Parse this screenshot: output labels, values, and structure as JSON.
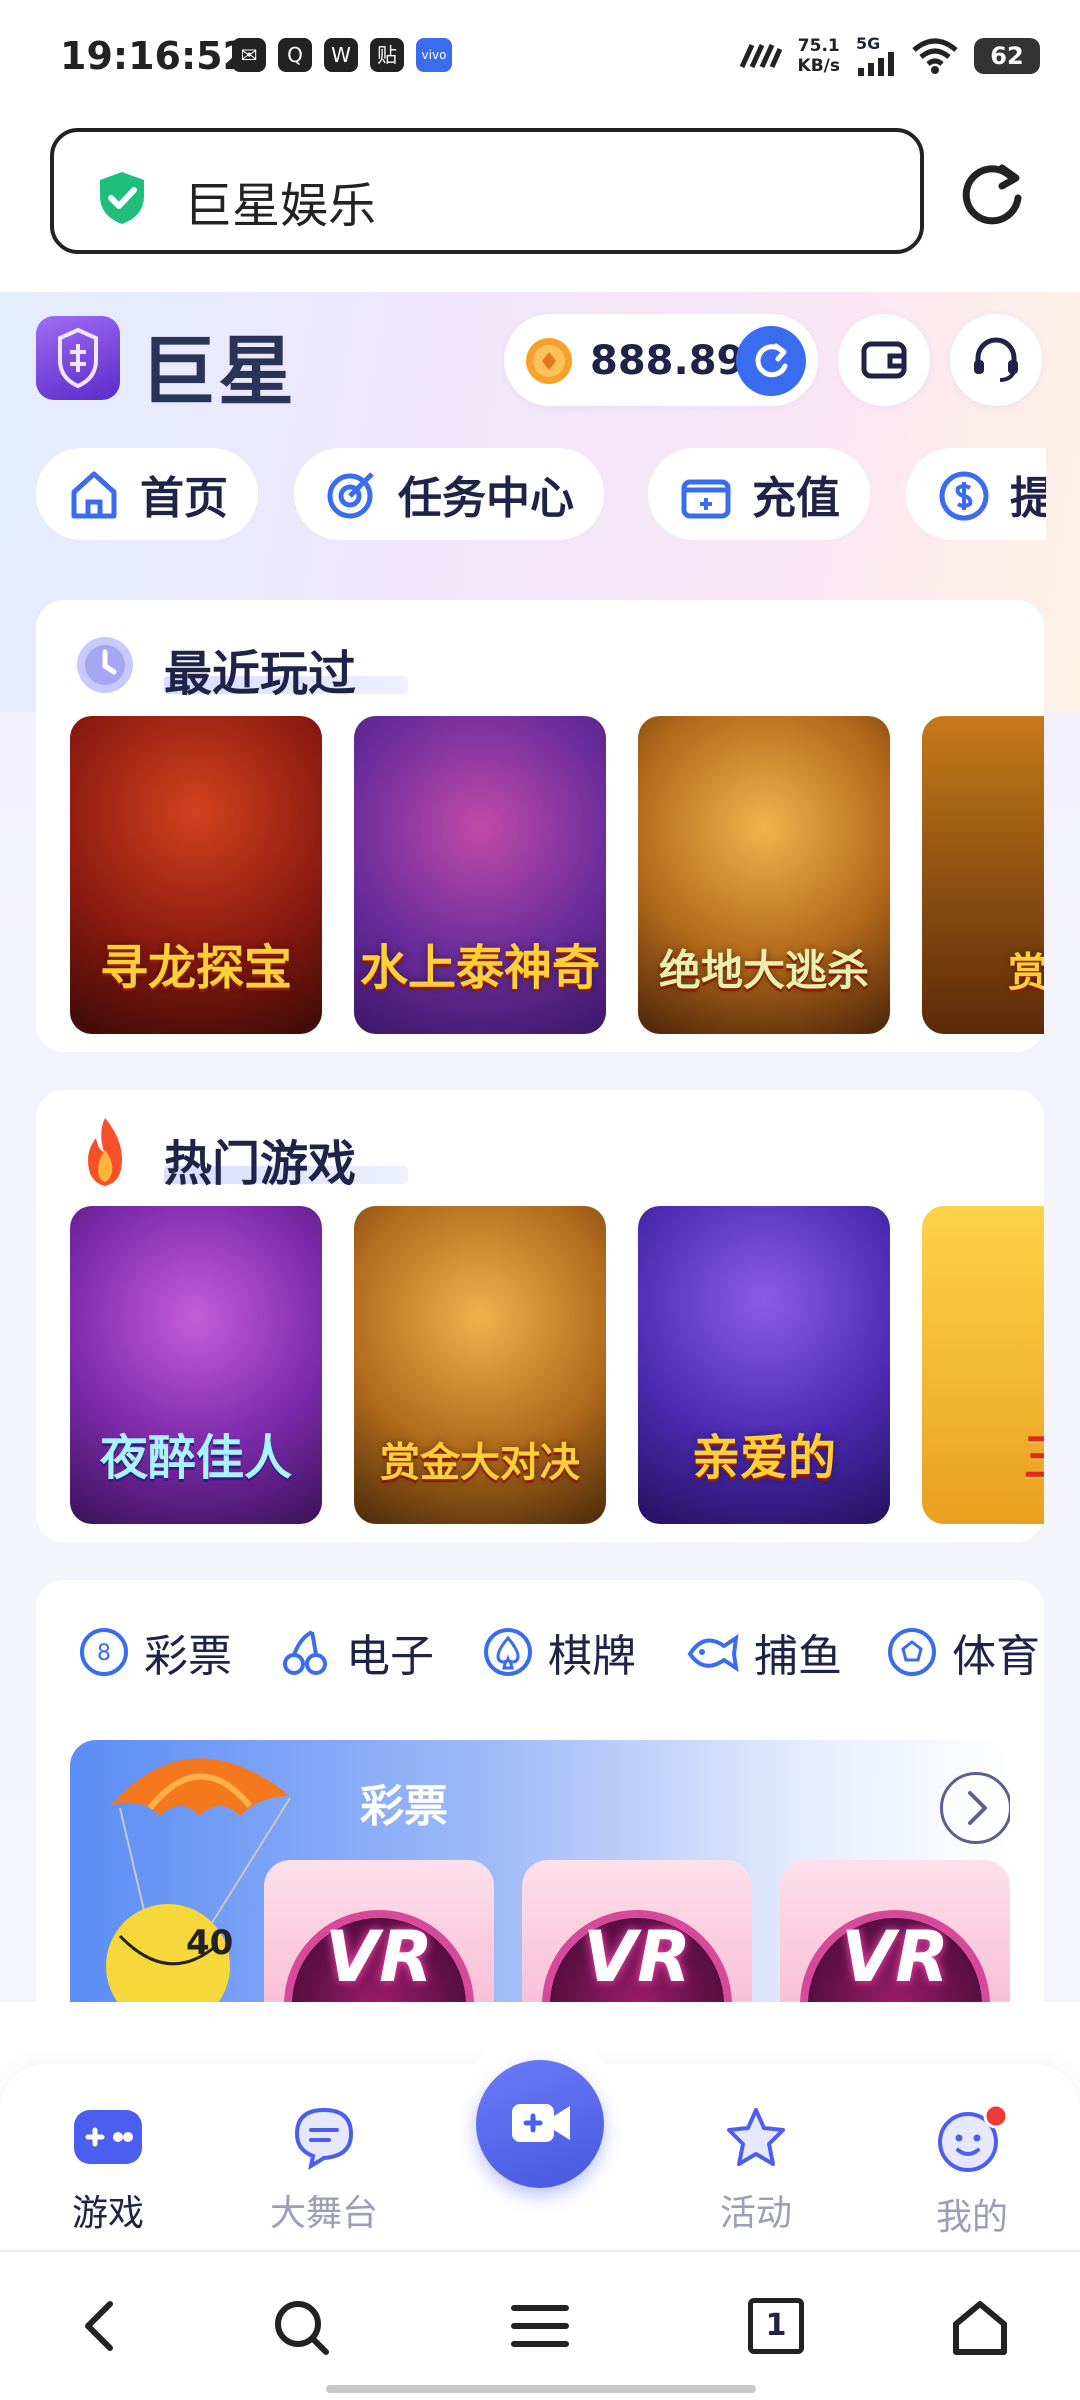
{
  "status_bar": {
    "time": "19:16:52",
    "app_icons": [
      "wechat-icon",
      "qq-icon",
      "weibo-icon",
      "tieba-icon",
      "vivo-icon"
    ],
    "app_icon_glyphs": [
      "✉",
      "Q",
      "W",
      "贴",
      "vivo"
    ],
    "net_speed_value": "75.1",
    "net_speed_unit": "KB/s",
    "network": "5G",
    "battery": "62"
  },
  "browser": {
    "url_text": "巨星娱乐",
    "secure": true
  },
  "site": {
    "brand": "巨星",
    "balance": "888.89",
    "nav": [
      {
        "label": "首页",
        "icon": "home-icon"
      },
      {
        "label": "任务中心",
        "icon": "target-icon"
      },
      {
        "label": "充值",
        "icon": "wallet-plus-icon"
      },
      {
        "label": "提现",
        "icon": "dollar-icon"
      }
    ]
  },
  "recent": {
    "title": "最近玩过",
    "games": [
      "寻龙探宝",
      "水上泰神奇",
      "绝地大逃杀",
      "赏金"
    ]
  },
  "hot": {
    "title": "热门游戏",
    "games": [
      "夜醉佳人",
      "赏金大对决",
      "亲爱的",
      "王"
    ]
  },
  "categories": {
    "items": [
      "彩票",
      "电子",
      "棋牌",
      "捕鱼",
      "体育"
    ],
    "banner_title": "彩票",
    "vr_labels": [
      "VR",
      "VR",
      "VR"
    ]
  },
  "tabbar": {
    "items": [
      {
        "label": "游戏",
        "active": true
      },
      {
        "label": "大舞台",
        "active": false
      },
      {
        "label": "活动",
        "active": false
      },
      {
        "label": "我的",
        "active": false
      }
    ]
  },
  "system_nav": {
    "tab_count": "1"
  },
  "colors": {
    "accent": "#3a6cf0",
    "text_dark": "#1f2348",
    "inactive": "#9aa0b6",
    "badge_red": "#f03a3a"
  }
}
